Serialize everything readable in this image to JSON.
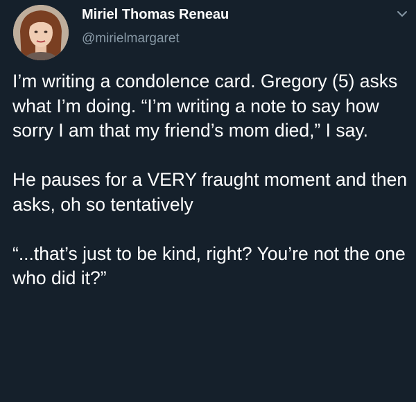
{
  "author": {
    "display_name": "Miriel Thomas Reneau",
    "handle": "@mirielmargaret"
  },
  "icons": {
    "avatar": "profile-photo",
    "menu": "chevron-down-icon"
  },
  "colors": {
    "background": "#15202b",
    "text": "#ffffff",
    "secondary_text": "#8899a6"
  },
  "tweet": {
    "paragraphs": [
      "I’m writing a condolence card. Gregory (5) asks what I’m doing. “I’m writing a note to say how sorry I am that my friend’s mom died,” I say.",
      "He pauses for a VERY fraught moment and then asks, oh so tentatively",
      "“...that’s just to be kind, right? You’re not the one who did it?”"
    ]
  }
}
